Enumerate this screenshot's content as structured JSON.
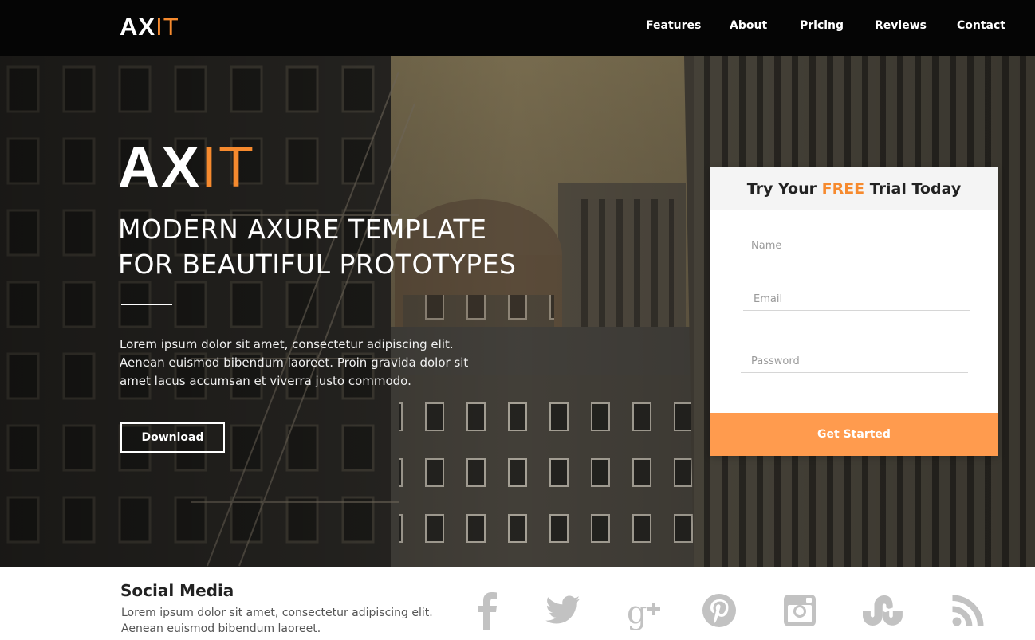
{
  "brand": {
    "logo_main": "AX",
    "logo_accent": "IT"
  },
  "nav": {
    "items": [
      "Features",
      "About",
      "Pricing",
      "Reviews",
      "Contact"
    ]
  },
  "hero": {
    "logo_main": "AX",
    "logo_accent": "IT",
    "headline_line1": "MODERN AXURE TEMPLATE",
    "headline_line2": "FOR BEAUTIFUL PROTOTYPES",
    "lead": "Lorem ipsum dolor sit amet, consectetur adipiscing elit. Aenean euismod bibendum laoreet. Proin gravida dolor sit amet lacus accumsan et viverra justo commodo.",
    "download_label": "Download"
  },
  "signup": {
    "title_before": "Try Your ",
    "title_highlight": "FREE",
    "title_after": " Trial Today",
    "name_placeholder": "Name",
    "email_placeholder": "Email",
    "password_placeholder": "Password",
    "submit_label": "Get Started"
  },
  "footer": {
    "title": "Social Media",
    "desc_line1": "Lorem ipsum dolor sit amet, consectetur adipiscing elit.",
    "desc_line2": "Aenean euismod bibendum laoreet.",
    "social_icons": [
      "facebook-icon",
      "twitter-icon",
      "google-plus-icon",
      "pinterest-icon",
      "instagram-icon",
      "stumbleupon-icon",
      "rss-icon"
    ],
    "icon_color": "#c2c2c2"
  },
  "colors": {
    "accent": "#f68a2e",
    "cta": "#ff9b4e",
    "topbar": "#050505"
  }
}
